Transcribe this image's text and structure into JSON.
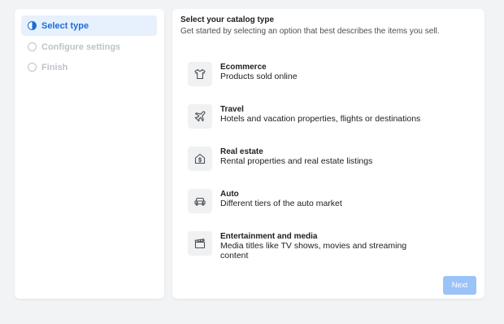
{
  "steps": [
    {
      "label": "Select type",
      "state": "active"
    },
    {
      "label": "Configure settings",
      "state": "inactive"
    },
    {
      "label": "Finish",
      "state": "inactive"
    }
  ],
  "main": {
    "heading": "Select your catalog type",
    "subheading": "Get started by selecting an option that best describes the items you sell.",
    "options": [
      {
        "icon": "tshirt-icon",
        "title": "Ecommerce",
        "description": "Products sold online"
      },
      {
        "icon": "airplane-icon",
        "title": "Travel",
        "description": "Hotels and vacation properties, flights or destinations"
      },
      {
        "icon": "house-dollar-icon",
        "title": "Real estate",
        "description": "Rental properties and real estate listings"
      },
      {
        "icon": "car-icon",
        "title": "Auto",
        "description": "Different tiers of the auto market"
      },
      {
        "icon": "clapperboard-icon",
        "title": "Entertainment and media",
        "description": "Media titles like TV shows, movies and streaming content"
      }
    ],
    "next_label": "Next"
  },
  "colors": {
    "accent": "#1a6ed8",
    "active_step_bg": "#e7f0fd",
    "disabled_button": "#9cc3f7",
    "page_bg": "#f2f3f5"
  }
}
